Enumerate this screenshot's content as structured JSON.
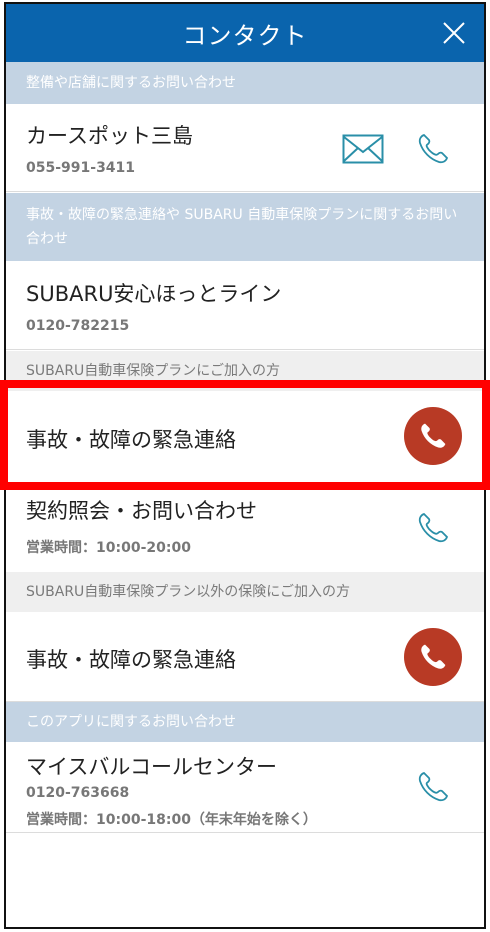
{
  "header": {
    "title": "コンタクト",
    "close_icon": "close-icon"
  },
  "sections": {
    "dealer": "整備や店舗に関するお問い合わせ",
    "emergency": "事故・故障の緊急連絡や SUBARU 自動車保険プランに関するお問い合わせ",
    "plan_members": "SUBARU自動車保険プランにご加入の方",
    "other_insurance": "SUBARU自動車保険プラン以外の保険にご加入の方",
    "app": "このアプリに関するお問い合わせ"
  },
  "dealer": {
    "name": "カースポット三島",
    "phone": "055-991-3411",
    "icons": [
      "mail-icon",
      "phone-icon"
    ]
  },
  "subaru_line": {
    "name": "SUBARU安心ほっとライン",
    "phone": "0120-782215"
  },
  "plan_emergency": {
    "name": "事故・故障の緊急連絡",
    "icon": "phone-icon"
  },
  "plan_contract": {
    "name": "契約照会・お問い合わせ",
    "hours": "営業時間：10:00-20:00",
    "icon": "phone-icon"
  },
  "other_emergency": {
    "name": "事故・故障の緊急連絡",
    "icon": "phone-icon"
  },
  "call_center": {
    "name": "マイスバルコールセンター",
    "phone": "0120-763668",
    "hours": "営業時間：10:00-18:00（年末年始を除く）",
    "icon": "phone-icon"
  },
  "colors": {
    "header": "#0a64ad",
    "section_blue": "#c3d3e3",
    "section_gray": "#efefef",
    "call_red": "#b83a25",
    "icon_teal": "#2a8fa8",
    "highlight": "#ff0000"
  }
}
